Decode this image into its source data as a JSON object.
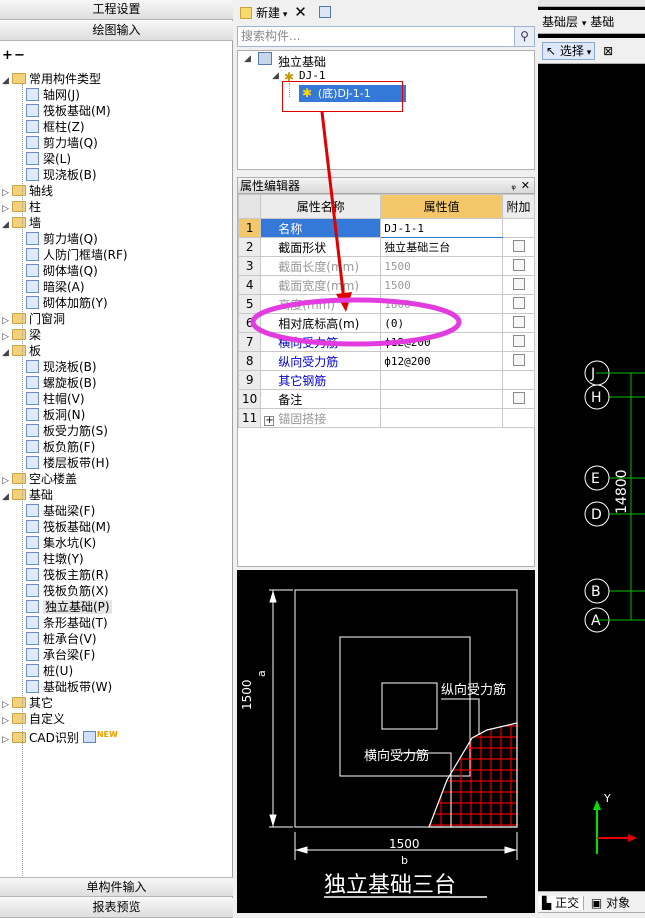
{
  "left": {
    "top_tabs": [
      "工程设置",
      "绘图输入"
    ],
    "expand_btns": [
      "+",
      "−"
    ],
    "tree": [
      {
        "label": "常用构件类型",
        "level": 0,
        "folder": true,
        "open": true
      },
      {
        "label": "轴网(J)",
        "level": 1
      },
      {
        "label": "筏板基础(M)",
        "level": 1
      },
      {
        "label": "框柱(Z)",
        "level": 1
      },
      {
        "label": "剪力墙(Q)",
        "level": 1
      },
      {
        "label": "梁(L)",
        "level": 1
      },
      {
        "label": "现浇板(B)",
        "level": 1
      },
      {
        "label": "轴线",
        "level": 0,
        "folder": true
      },
      {
        "label": "柱",
        "level": 0,
        "folder": true
      },
      {
        "label": "墙",
        "level": 0,
        "folder": true,
        "open": true
      },
      {
        "label": "剪力墙(Q)",
        "level": 1
      },
      {
        "label": "人防门框墙(RF)",
        "level": 1
      },
      {
        "label": "砌体墙(Q)",
        "level": 1
      },
      {
        "label": "暗梁(A)",
        "level": 1
      },
      {
        "label": "砌体加筋(Y)",
        "level": 1
      },
      {
        "label": "门窗洞",
        "level": 0,
        "folder": true
      },
      {
        "label": "梁",
        "level": 0,
        "folder": true
      },
      {
        "label": "板",
        "level": 0,
        "folder": true,
        "open": true
      },
      {
        "label": "现浇板(B)",
        "level": 1
      },
      {
        "label": "螺旋板(B)",
        "level": 1
      },
      {
        "label": "柱帽(V)",
        "level": 1
      },
      {
        "label": "板洞(N)",
        "level": 1
      },
      {
        "label": "板受力筋(S)",
        "level": 1
      },
      {
        "label": "板负筋(F)",
        "level": 1
      },
      {
        "label": "楼层板带(H)",
        "level": 1
      },
      {
        "label": "空心楼盖",
        "level": 0,
        "folder": true
      },
      {
        "label": "基础",
        "level": 0,
        "folder": true,
        "open": true
      },
      {
        "label": "基础梁(F)",
        "level": 1
      },
      {
        "label": "筏板基础(M)",
        "level": 1
      },
      {
        "label": "集水坑(K)",
        "level": 1
      },
      {
        "label": "柱墩(Y)",
        "level": 1
      },
      {
        "label": "筏板主筋(R)",
        "level": 1
      },
      {
        "label": "筏板负筋(X)",
        "level": 1
      },
      {
        "label": "独立基础(P)",
        "level": 1,
        "selected": true
      },
      {
        "label": "条形基础(T)",
        "level": 1
      },
      {
        "label": "桩承台(V)",
        "level": 1
      },
      {
        "label": "承台梁(F)",
        "level": 1
      },
      {
        "label": "桩(U)",
        "level": 1
      },
      {
        "label": "基础板带(W)",
        "level": 1
      },
      {
        "label": "其它",
        "level": 0,
        "folder": true
      },
      {
        "label": "自定义",
        "level": 0,
        "folder": true
      },
      {
        "label": "CAD识别",
        "level": 0,
        "folder": true,
        "badge": "NEW"
      }
    ],
    "bottom_tabs": [
      "单构件输入",
      "报表预览"
    ]
  },
  "mid": {
    "toolbar": {
      "new_label": "新建"
    },
    "search_placeholder": "搜索构件...",
    "comp_tree": {
      "root": "独立基础",
      "child": "DJ-1",
      "leaf": "(底)DJ-1-1"
    },
    "props": {
      "title": "属性编辑器",
      "col_name": "属性名称",
      "col_value": "属性值",
      "col_extra": "附加",
      "rows": [
        {
          "n": "1",
          "name": "名称",
          "value": "DJ-1-1",
          "cls": "blue",
          "chk": false,
          "sel": true
        },
        {
          "n": "2",
          "name": "截面形状",
          "value": "独立基础三台",
          "cls": "",
          "chk": true
        },
        {
          "n": "3",
          "name": "截面长度(mm)",
          "value": "1500",
          "cls": "gray",
          "chk": true,
          "vgray": true
        },
        {
          "n": "4",
          "name": "截面宽度(mm)",
          "value": "1500",
          "cls": "gray",
          "chk": true,
          "vgray": true
        },
        {
          "n": "5",
          "name": "高度(mm)",
          "value": "1800",
          "cls": "gray",
          "chk": true,
          "vgray": true
        },
        {
          "n": "6",
          "name": "相对底标高(m)",
          "value": "(0)",
          "cls": "",
          "chk": true
        },
        {
          "n": "7",
          "name": "横向受力筋",
          "value": "ф12@200",
          "cls": "blue",
          "chk": true
        },
        {
          "n": "8",
          "name": "纵向受力筋",
          "value": "ф12@200",
          "cls": "blue",
          "chk": true
        },
        {
          "n": "9",
          "name": "其它钢筋",
          "value": "",
          "cls": "blue",
          "chk": false
        },
        {
          "n": "10",
          "name": "备注",
          "value": "",
          "cls": "",
          "chk": true
        },
        {
          "n": "11",
          "name": "锚固搭接",
          "value": "",
          "cls": "gray",
          "chk": false,
          "expand": true
        }
      ]
    },
    "preview": {
      "dim_a": "1500",
      "dim_a_letter": "a",
      "dim_b": "1500",
      "dim_b_letter": "b",
      "label_long": "纵向受力筋",
      "label_trans": "横向受力筋",
      "caption": "独立基础三台"
    }
  },
  "right": {
    "toolbar1": [
      "基础层",
      "基础"
    ],
    "toolbar2": [
      "选择"
    ],
    "axes": [
      "J",
      "H",
      "E",
      "D",
      "B",
      "A"
    ],
    "dim_text": "14800",
    "y_label": "Y",
    "bottom_tabs": [
      "正交",
      "对象"
    ]
  },
  "colors": {
    "accent": "#3a78d8",
    "highlight_oval": "#e23be0",
    "red": "#e00000"
  }
}
